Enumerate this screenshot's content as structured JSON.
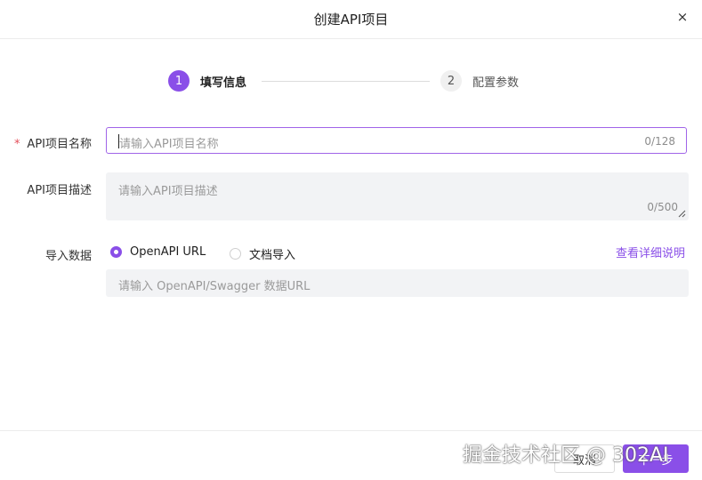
{
  "dialog": {
    "title": "创建API项目",
    "close_icon": "×"
  },
  "steps": [
    {
      "number": "1",
      "label": "填写信息",
      "state": "active"
    },
    {
      "number": "2",
      "label": "配置参数",
      "state": "inactive"
    }
  ],
  "form": {
    "name": {
      "label": "API项目名称",
      "required_mark": "*",
      "placeholder": "请输入API项目名称",
      "counter": "0/128"
    },
    "description": {
      "label": "API项目描述",
      "placeholder": "请输入API项目描述",
      "counter": "0/500"
    },
    "import": {
      "label": "导入数据",
      "options": [
        {
          "label": "OpenAPI URL",
          "checked": true
        },
        {
          "label": "文档导入",
          "checked": false
        }
      ],
      "detail_link": "查看详细说明",
      "url_placeholder": "请输入 OpenAPI/Swagger 数据URL"
    }
  },
  "footer": {
    "cancel_label": "取消",
    "next_label": "下一步"
  },
  "watermark": "掘金技术社区 @ 302AI",
  "colors": {
    "accent": "#8a4fe8",
    "required": "#e34d59"
  },
  "icons": {
    "close": "close-icon",
    "resize": "resize-handle-icon"
  }
}
